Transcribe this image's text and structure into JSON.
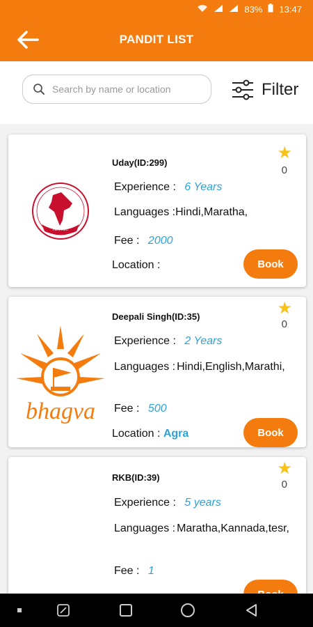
{
  "status_bar": {
    "battery": "83%",
    "time": "13:47"
  },
  "app_bar": {
    "title": "PANDIT LIST"
  },
  "search": {
    "placeholder": "Search by name or location"
  },
  "filter": {
    "label": "Filter"
  },
  "pandits": [
    {
      "name": "Uday(ID:299)",
      "experience_label": "Experience :",
      "experience": "6 Years",
      "languages_label": "Languages :",
      "languages": "Hindi,Maratha,",
      "fee_label": "Fee :",
      "fee": "2000",
      "location_label": "Location :",
      "location": "",
      "rating": "0",
      "book_label": "Book",
      "logo_text": "AITMC"
    },
    {
      "name": "Deepali Singh(ID:35)",
      "experience_label": "Experience :",
      "experience": "2 Years",
      "languages_label": "Languages :",
      "languages": "Hindi,English,Marathi,",
      "fee_label": "Fee :",
      "fee": "500",
      "location_label": "Location :",
      "location": "Agra",
      "rating": "0",
      "book_label": "Book",
      "logo_text": "bhagva"
    },
    {
      "name": "RKB(ID:39)",
      "experience_label": "Experience :",
      "experience": "5 years",
      "languages_label": "Languages :",
      "languages": "Maratha,Kannada,tesr,",
      "fee_label": "Fee :",
      "fee": "1",
      "rating": "0",
      "book_label": "Book"
    }
  ],
  "colors": {
    "primary": "#f47c0f",
    "accent_text": "#2aa3d8",
    "star": "#f8c21a"
  }
}
